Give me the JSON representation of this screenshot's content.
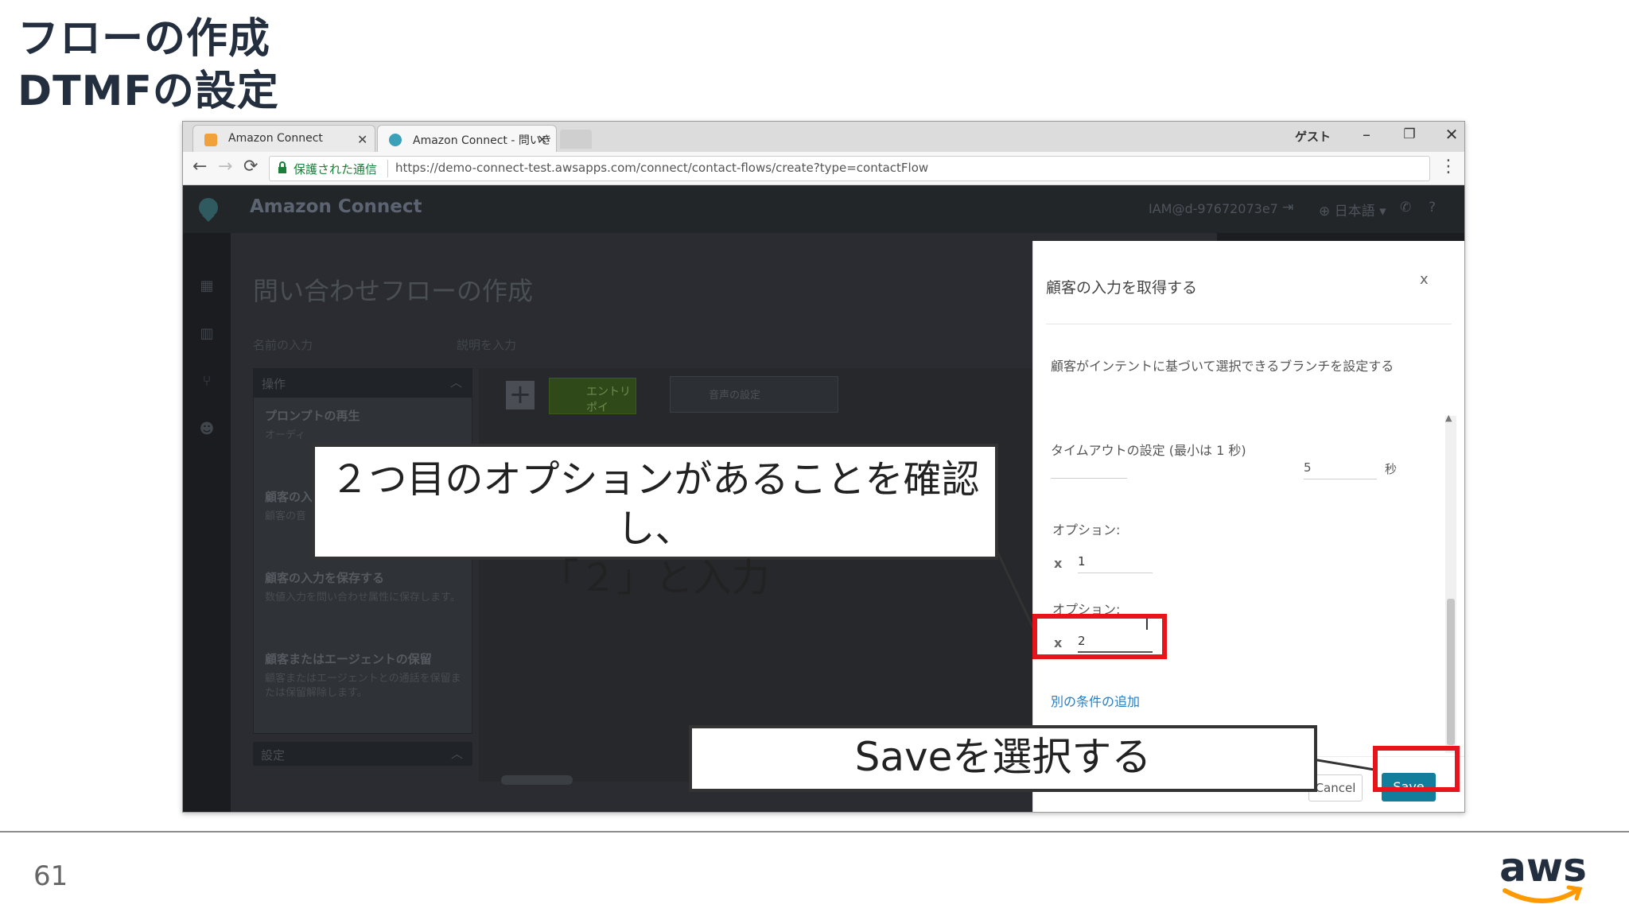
{
  "slide": {
    "title_line1": "フローの作成",
    "title_line2": "DTMFの設定",
    "page_number": "61",
    "logo_text": "aws"
  },
  "browser": {
    "tabs": [
      {
        "label": "Amazon Connect",
        "icon": "amazon-box-icon"
      },
      {
        "label": "Amazon Connect - 問いき",
        "icon": "amazon-connect-icon"
      }
    ],
    "window_user": "ゲスト",
    "secure_label": "保護された通信",
    "url": "https://demo-connect-test.awsapps.com/connect/contact-flows/create?type=contactFlow"
  },
  "app": {
    "name": "Amazon Connect",
    "user": "IAM@d-97672073e7",
    "language": "日本語",
    "help": "?",
    "page_title": "問い合わせフローの作成",
    "name_placeholder": "名前の入力",
    "desc_placeholder": "説明を入力",
    "ops_header": "操作",
    "operations": [
      {
        "title": "プロンプトの再生",
        "desc": "オーディ"
      },
      {
        "title": "顧客の入",
        "desc": "顧客の音"
      },
      {
        "title": "顧客の入力を保存する",
        "desc": "数値入力を問い合わせ属性に保存します。"
      },
      {
        "title": "顧客またはエージェントの保留",
        "desc": "顧客またはエージェントとの通話を保留または保留解除します。"
      }
    ],
    "settings_header": "設定",
    "canvas_entry": "エントリポイ",
    "canvas_voice": "音声の設定"
  },
  "dialog": {
    "title": "顧客の入力を取得する",
    "close": "x",
    "description": "顧客がインテントに基づいて選択できるブランチを設定する",
    "timeout_label": "タイムアウトの設定 (最小は 1 秒)",
    "timeout_value": "5",
    "timeout_unit": "秒",
    "options": [
      {
        "label": "オプション:",
        "remove": "x",
        "value": "1"
      },
      {
        "label": "オプション:",
        "remove": "x",
        "value": "2"
      }
    ],
    "add_condition": "別の条件の追加",
    "cancel_label": "Cancel",
    "save_label": "Save"
  },
  "callouts": {
    "option_note_line1": "２つ目のオプションがあることを確認し、",
    "option_note_line2": "「２」と入力",
    "save_note": "Saveを選択する"
  },
  "colors": {
    "highlight": "#e8141c",
    "save_button": "#137e9c",
    "aws_orange": "#ff9900",
    "slide_title": "#232f3e"
  }
}
